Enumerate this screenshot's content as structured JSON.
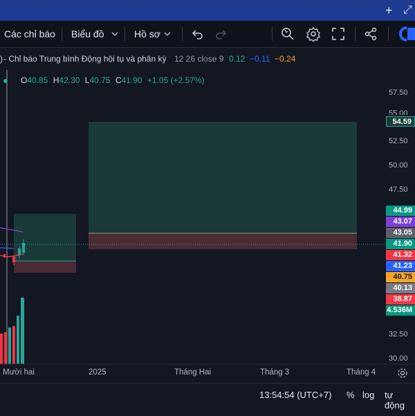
{
  "toolbar": {
    "indicators_label": "Các chỉ báo",
    "chart_label": "Biểu đồ",
    "profile_label": "Hồ sơ",
    "icons": [
      "undo-icon",
      "redo-icon",
      "search-zoom-icon",
      "gear-icon",
      "fullscreen-icon",
      "share-icon",
      "logo-icon"
    ]
  },
  "topbar": {
    "plus": "+",
    "expand": "⤢"
  },
  "info": {
    "prefix": ")",
    "indicator": " - Chỉ báo Trung bình Động hội tụ và phân kỳ",
    "params": "12 26 close 9",
    "macd": "0.12",
    "signal": "−0.11",
    "hist": "−0.24",
    "colors": {
      "macd": "#26a69a",
      "signal": "#2962ff",
      "hist": "#f5a623"
    }
  },
  "ohlc": {
    "o_key": "O",
    "o_val": "40.85",
    "h_key": "H",
    "h_val": "42.30",
    "l_key": "L",
    "l_val": "40.75",
    "c_key": "C",
    "c_val": "41.90",
    "change": "+1.05 (+2.57%)"
  },
  "price_axis": {
    "ticks": [
      "57.50",
      "52.50",
      "50.00",
      "47.50",
      "32.50",
      "30.00"
    ],
    "partial_tick": "55.00",
    "labels": [
      {
        "text": "54.59",
        "bg": "#1b3d39",
        "border": "#26a69a",
        "color": "#ffffff"
      },
      {
        "text": "44.99",
        "bg": "#089981",
        "color": "#ffffff"
      },
      {
        "text": "43.07",
        "bg": "#7e3fd6",
        "color": "#ffffff"
      },
      {
        "text": "43.05",
        "bg": "#5d606b",
        "color": "#ffffff"
      },
      {
        "text": "41.90",
        "bg": "#089981",
        "color": "#ffffff"
      },
      {
        "text": "41.32",
        "bg": "#f23645",
        "color": "#ffffff"
      },
      {
        "text": "41.23",
        "bg": "#2962ff",
        "color": "#ffffff"
      },
      {
        "text": "40.75",
        "bg": "#f5a623",
        "color": "#131722"
      },
      {
        "text": "40.13",
        "bg": "#787b86",
        "color": "#ffffff"
      },
      {
        "text": "38.87",
        "bg": "#f23645",
        "color": "#ffffff"
      },
      {
        "text": "4.536M",
        "bg": "#089981",
        "color": "#ffffff"
      }
    ]
  },
  "time_axis": [
    "Mười hai",
    "2025",
    "Tháng Hai",
    "Tháng 3",
    "Tháng 4"
  ],
  "bottom": {
    "time": "13:54:54 (UTC+7)",
    "percent": "%",
    "log": "log",
    "auto": "tự động"
  }
}
